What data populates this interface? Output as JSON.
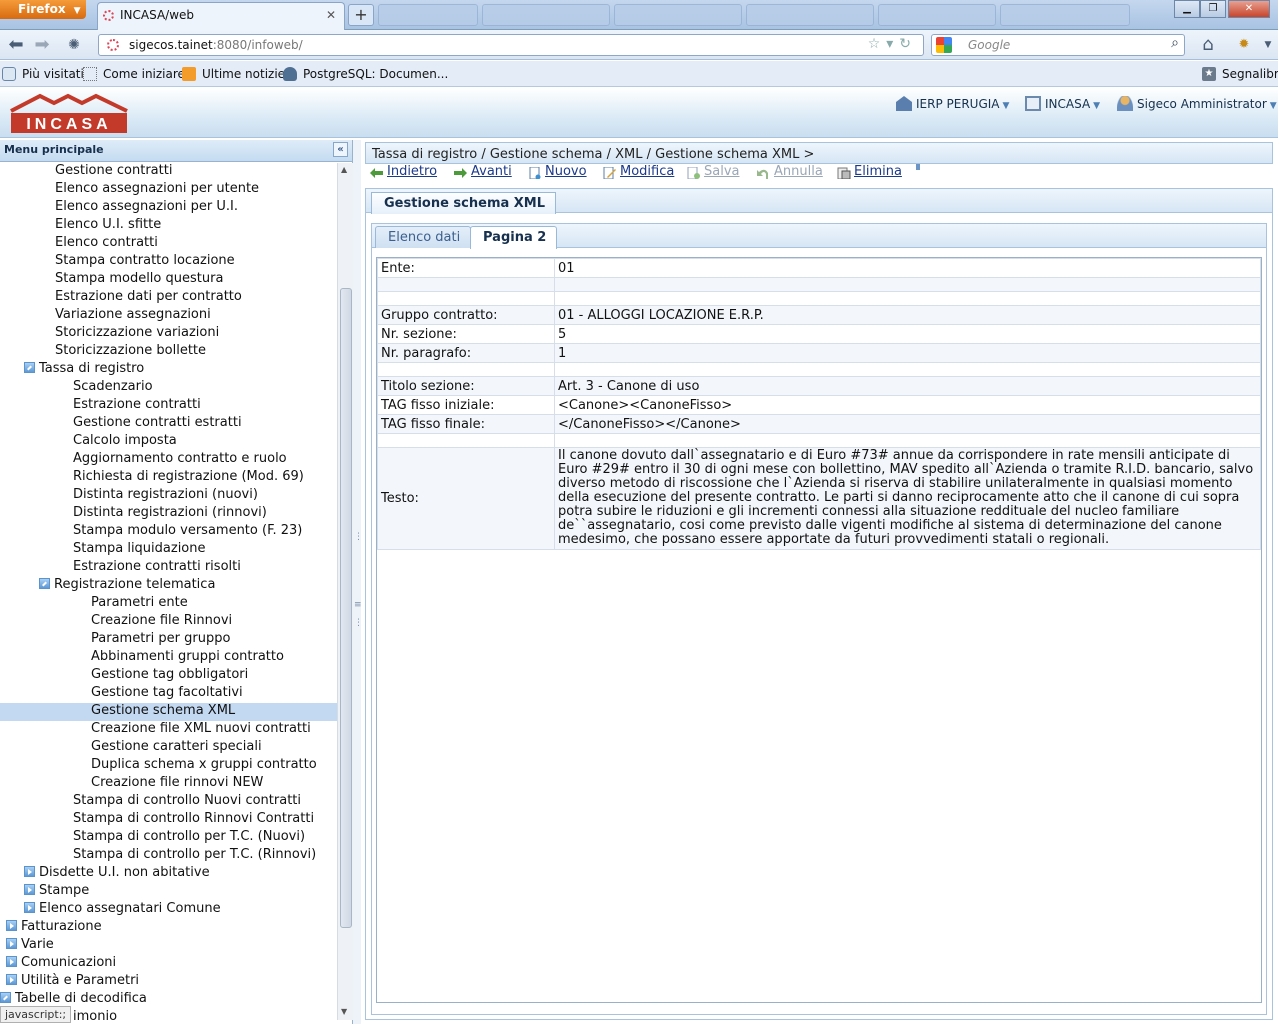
{
  "browser": {
    "menu_label": "Firefox",
    "tab_title": "INCASA/web",
    "url_host": "sigecos.tainet",
    "url_rest": ":8080/infoweb/",
    "search_placeholder": "Google",
    "bookmarks": [
      "Più visitati",
      "Come iniziare",
      "Ultime notizie",
      "PostgreSQL: Documen..."
    ],
    "bookmarks_menu": "Segnalibri",
    "status_text": "javascript:;"
  },
  "app": {
    "logo_text": "INCASA",
    "header_menus": [
      "IERP PERUGIA",
      "INCASA",
      "Sigeco Amministrator"
    ],
    "accent_color": "#c33a2a"
  },
  "sidebar": {
    "title": "Menu principale",
    "items": [
      {
        "label": "Gestione contratti",
        "level": 2
      },
      {
        "label": "Elenco assegnazioni per utente",
        "level": 2
      },
      {
        "label": "Elenco assegnazioni per U.I.",
        "level": 2
      },
      {
        "label": "Elenco U.I. sfitte",
        "level": 2
      },
      {
        "label": "Elenco contratti",
        "level": 2
      },
      {
        "label": "Stampa contratto locazione",
        "level": 2
      },
      {
        "label": "Stampa modello questura",
        "level": 2
      },
      {
        "label": "Estrazione dati per contratto",
        "level": 2
      },
      {
        "label": "Variazione assegnazioni",
        "level": 2
      },
      {
        "label": "Storicizzazione variazioni",
        "level": 2
      },
      {
        "label": "Storicizzazione bollette",
        "level": 2
      },
      {
        "label": "Tassa di registro",
        "level": 1,
        "expander": "open"
      },
      {
        "label": "Scadenzario",
        "level": 3
      },
      {
        "label": "Estrazione contratti",
        "level": 3
      },
      {
        "label": "Gestione contratti estratti",
        "level": 3
      },
      {
        "label": "Calcolo imposta",
        "level": 3
      },
      {
        "label": "Aggiornamento contratto e ruolo",
        "level": 3
      },
      {
        "label": "Richiesta di registrazione (Mod. 69)",
        "level": 3
      },
      {
        "label": "Distinta registrazioni (nuovi)",
        "level": 3
      },
      {
        "label": "Distinta registrazioni (rinnovi)",
        "level": 3
      },
      {
        "label": "Stampa modulo versamento (F. 23)",
        "level": 3
      },
      {
        "label": "Stampa liquidazione",
        "level": 3
      },
      {
        "label": "Estrazione contratti risolti",
        "level": 3
      },
      {
        "label": "Registrazione telematica",
        "level": 2,
        "expander": "open"
      },
      {
        "label": "Parametri ente",
        "level": 4
      },
      {
        "label": "Creazione file Rinnovi",
        "level": 4
      },
      {
        "label": "Parametri per gruppo",
        "level": 4
      },
      {
        "label": "Abbinamenti gruppi contratto",
        "level": 4
      },
      {
        "label": "Gestione tag obbligatori",
        "level": 4
      },
      {
        "label": "Gestione tag facoltativi",
        "level": 4
      },
      {
        "label": "Gestione schema XML",
        "level": 4,
        "selected": true
      },
      {
        "label": "Creazione file XML nuovi contratti",
        "level": 4
      },
      {
        "label": "Gestione caratteri speciali",
        "level": 4
      },
      {
        "label": "Duplica schema x gruppi contratto",
        "level": 4
      },
      {
        "label": "Creazione file rinnovi NEW",
        "level": 4
      },
      {
        "label": "Stampa di controllo Nuovi contratti",
        "level": 3
      },
      {
        "label": "Stampa di controllo Rinnovi Contratti",
        "level": 3
      },
      {
        "label": "Stampa di controllo per T.C. (Nuovi)",
        "level": 3
      },
      {
        "label": "Stampa di controllo per T.C. (Rinnovi)",
        "level": 3
      },
      {
        "label": "Disdette U.I. non abitative",
        "level": 1,
        "expander": "closed"
      },
      {
        "label": "Stampe",
        "level": 1,
        "expander": "closed"
      },
      {
        "label": "Elenco assegnatari Comune",
        "level": 1,
        "expander": "closed"
      },
      {
        "label": "Fatturazione",
        "level": 0,
        "expander": "closed"
      },
      {
        "label": "Varie",
        "level": 0,
        "expander": "closed"
      },
      {
        "label": "Comunicazioni",
        "level": 0,
        "expander": "closed"
      },
      {
        "label": "Utilità e Parametri",
        "level": 0,
        "expander": "closed"
      },
      {
        "label": "Tabelle di decodifica",
        "level": -1,
        "expander": "open"
      },
      {
        "label": "imonio",
        "level": 3
      }
    ]
  },
  "main": {
    "breadcrumb": "Tassa di registro / Gestione schema / XML / Gestione schema XML >",
    "toolbar": [
      {
        "label": " Indietro",
        "enabled": true,
        "icon": "arrow-left-icon"
      },
      {
        "label": " Avanti",
        "enabled": true,
        "icon": "arrow-right-icon"
      },
      {
        "label": "Nuovo",
        "enabled": true,
        "icon": "new-document-icon"
      },
      {
        "label": "Modifica",
        "enabled": true,
        "icon": "edit-icon"
      },
      {
        "label": "Salva",
        "enabled": false,
        "icon": "save-icon"
      },
      {
        "label": "Annulla",
        "enabled": false,
        "icon": "undo-icon"
      },
      {
        "label": " Elimina",
        "enabled": true,
        "icon": "delete-icon"
      }
    ],
    "panel_title": "Gestione schema XML",
    "tabs": [
      "Elenco dati",
      "Pagina 2"
    ],
    "active_tab": "Pagina 2",
    "fields": [
      {
        "label": "Ente:",
        "value": "01"
      },
      {
        "label": "",
        "value": ""
      },
      {
        "label": "",
        "value": ""
      },
      {
        "label": "Gruppo contratto:",
        "value": "01 - ALLOGGI LOCAZIONE E.R.P."
      },
      {
        "label": "Nr. sezione:",
        "value": "5"
      },
      {
        "label": "Nr. paragrafo:",
        "value": "1"
      },
      {
        "label": "",
        "value": ""
      },
      {
        "label": "Titolo sezione:",
        "value": "Art. 3 - Canone di uso"
      },
      {
        "label": "TAG fisso iniziale:",
        "value": "<Canone><CanoneFisso>"
      },
      {
        "label": "TAG fisso finale:",
        "value": "</CanoneFisso></Canone>"
      },
      {
        "label": "",
        "value": ""
      },
      {
        "label": "Testo:",
        "value": "Il canone dovuto dall`assegnatario e di Euro #73# annue da corrispondere in rate mensili anticipate di Euro #29# entro il 30 di ogni mese con bollettino, MAV spedito all`Azienda o tramite R.I.D. bancario, salvo diverso metodo di riscossione che l`Azienda si riserva di stabilire unilateralmente in qualsiasi momento della esecuzione del presente contratto. Le parti si danno reciprocamente atto che il canone di cui sopra potra subire le riduzioni e gli incrementi connessi alla situazione reddituale del nucleo familiare de``assegnatario, cosi come previsto dalle vigenti modifiche al sistema di determinazione del canone medesimo, che possano essere apportate da futuri provvedimenti statali o regionali."
      }
    ]
  }
}
